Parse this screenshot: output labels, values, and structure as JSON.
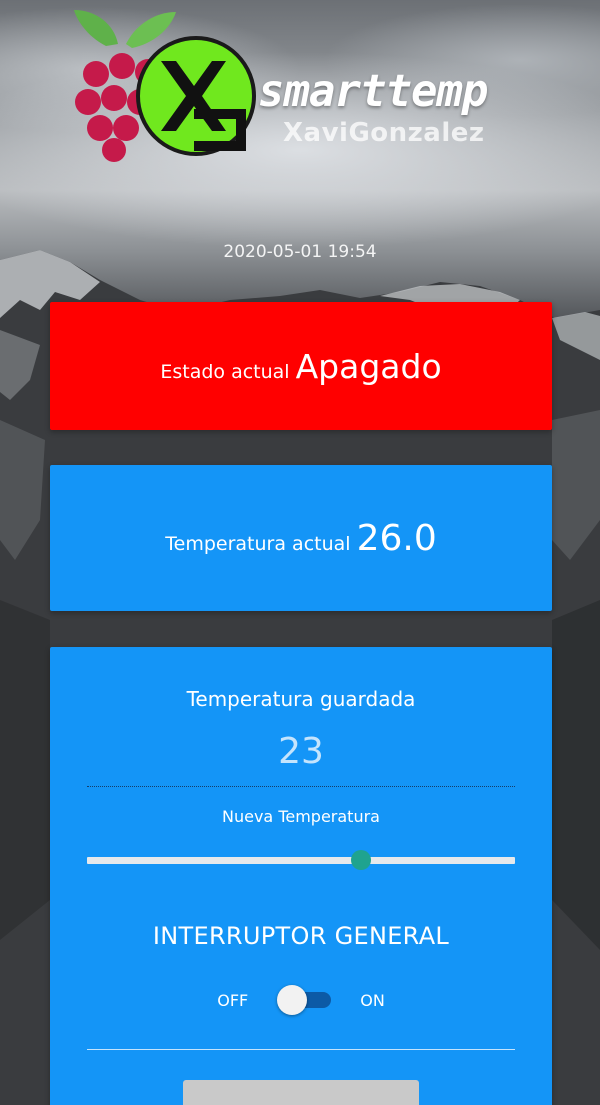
{
  "header": {
    "brand": "smarttemp",
    "author": "XaviGonzalez",
    "datetime": "2020-05-01 19:54"
  },
  "status": {
    "label": "Estado actual",
    "value": "Apagado",
    "color": "#ff0000"
  },
  "temperature": {
    "label": "Temperatura actual",
    "value": "26.0"
  },
  "control": {
    "saved_label": "Temperatura guardada",
    "saved_value": "23",
    "new_label": "Nueva Temperatura",
    "slider_fraction": 0.64,
    "switch_title": "INTERRUPTOR GENERAL",
    "switch_off": "OFF",
    "switch_on": "ON",
    "switch_state": "off",
    "accent": "#1495f7"
  }
}
